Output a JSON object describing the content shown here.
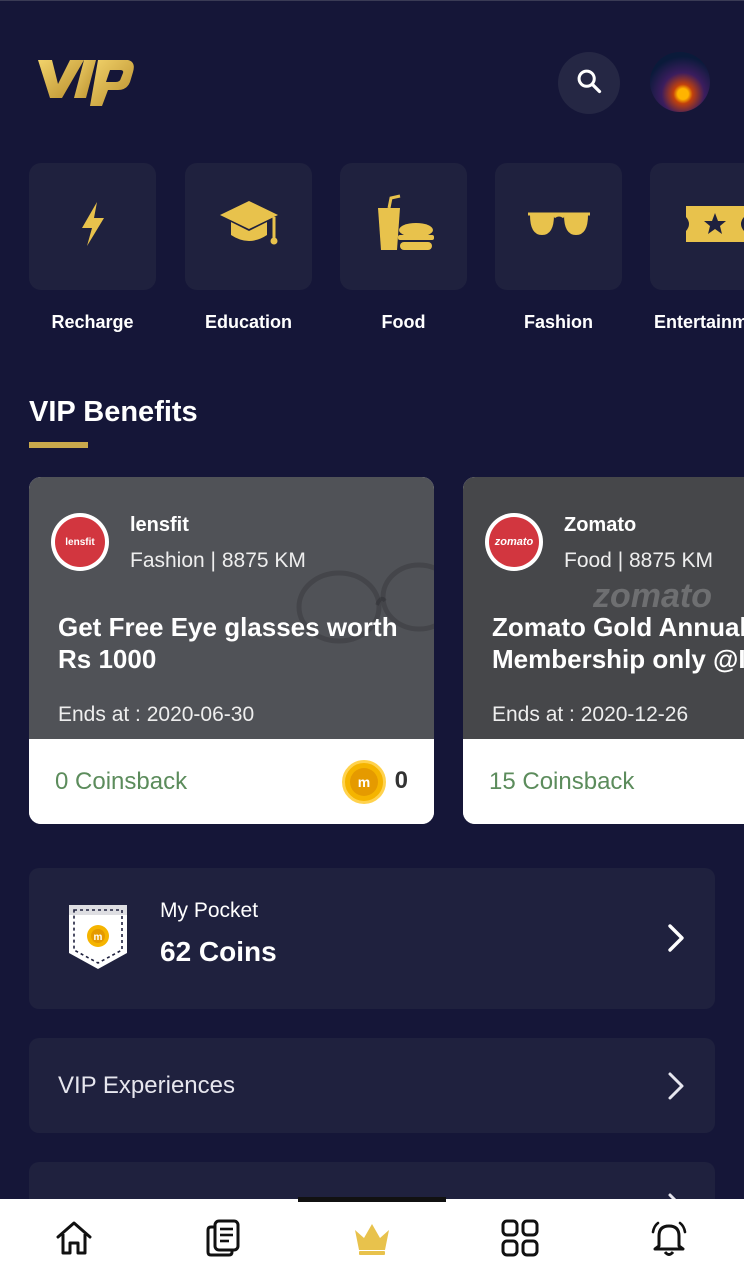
{
  "header": {
    "logo_text": "vip",
    "search_icon": "search-icon",
    "avatar": "profile-avatar"
  },
  "categories": [
    {
      "label": "Recharge",
      "icon": "lightning-icon"
    },
    {
      "label": "Education",
      "icon": "graduation-cap-icon"
    },
    {
      "label": "Food",
      "icon": "fast-food-icon"
    },
    {
      "label": "Fashion",
      "icon": "sunglasses-icon"
    },
    {
      "label": "Entertainm",
      "icon": "ticket-star-icon"
    }
  ],
  "benefits": {
    "title": "VIP Benefits",
    "offers": [
      {
        "brand": "lensfit",
        "brand_logo_text": "lensfit",
        "meta": "Fashion | 8875 KM",
        "title_line1": "Get Free Eye glasses worth",
        "title_line2": "Rs 1000",
        "ends": "Ends at : 2020-06-30",
        "coinsback": "0 Coinsback",
        "coins": "0"
      },
      {
        "brand": "Zomato",
        "brand_logo_text": "zomato",
        "meta": "Food | 8875 KM",
        "title_line1": "Zomato Gold Annual",
        "title_line2": "Membership only @I",
        "ends": "Ends at : 2020-12-26",
        "coinsback": "15 Coinsback",
        "watermark": "zomato"
      }
    ]
  },
  "pocket": {
    "label": "My Pocket",
    "value": "62 Coins"
  },
  "rows": [
    {
      "label": "VIP Experiences"
    }
  ],
  "nav": [
    {
      "name": "home",
      "icon": "home-icon"
    },
    {
      "name": "orders",
      "icon": "document-icon"
    },
    {
      "name": "vip",
      "icon": "crown-icon",
      "active": true
    },
    {
      "name": "apps",
      "icon": "grid-icon"
    },
    {
      "name": "notifications",
      "icon": "bell-icon"
    }
  ],
  "colors": {
    "background": "#151638",
    "card": "#1f213e",
    "accent": "#e8c24c",
    "coinsback_green": "#5c8c5c"
  }
}
